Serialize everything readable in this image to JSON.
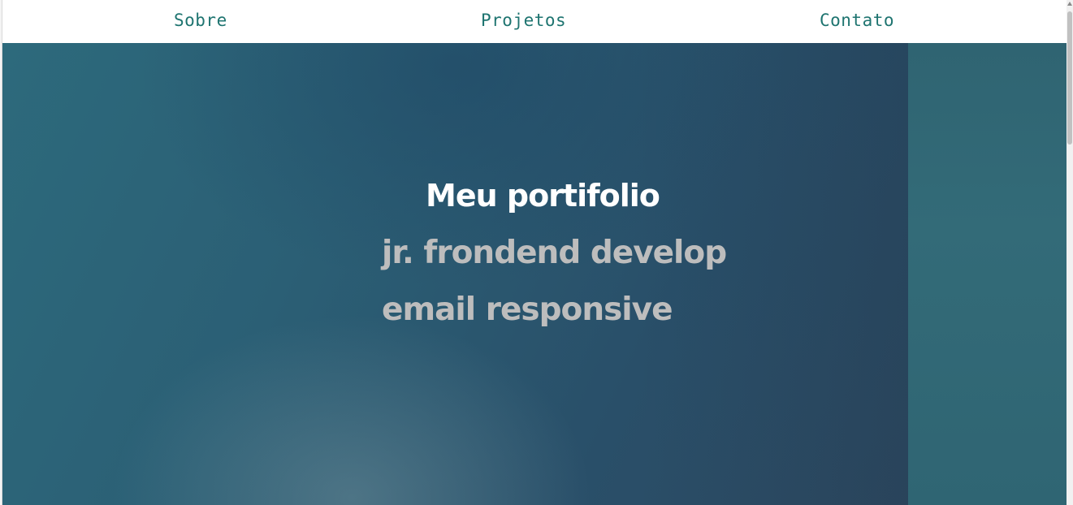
{
  "nav": {
    "items": [
      {
        "label": "Sobre"
      },
      {
        "label": "Projetos"
      },
      {
        "label": "Contato"
      }
    ]
  },
  "hero": {
    "title": "Meu portifolio",
    "lines": [
      "jr. frondend develop",
      "email responsive"
    ]
  },
  "colors": {
    "nav_link": "#1e7470",
    "hero_background": "#2b5f75",
    "hero_side": "#336b78",
    "title_text": "#ffffff",
    "subtitle_text": "#bdbdbd"
  }
}
